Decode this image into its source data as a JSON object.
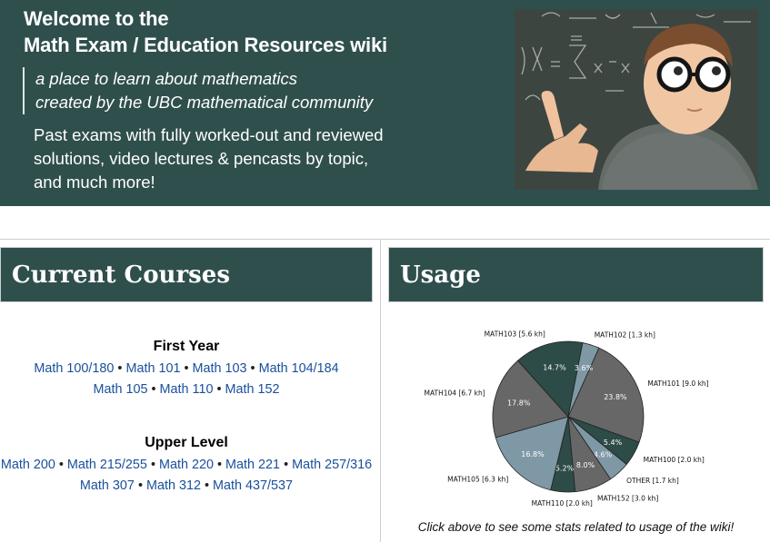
{
  "banner": {
    "title_line1": "Welcome to the",
    "title_line2": "Math Exam / Education Resources wiki",
    "tagline_line1": "a place to learn about mathematics",
    "tagline_line2": "created by the UBC mathematical community",
    "blurb_line1": "Past exams with fully worked-out and reviewed",
    "blurb_line2": "solutions, video lectures & pencasts by topic,",
    "blurb_line3": "and much more!"
  },
  "courses": {
    "heading": "Current Courses",
    "first_year": {
      "title": "First Year",
      "links": [
        "Math 100/180",
        "Math 101",
        "Math 103",
        "Math 104/184",
        "Math 105",
        "Math 110",
        "Math 152"
      ]
    },
    "upper_level": {
      "title": "Upper Level",
      "links": [
        "Math 200",
        "Math 215/255",
        "Math 220",
        "Math 221",
        "Math 257/316",
        "Math 307",
        "Math 312",
        "Math 437/537"
      ]
    }
  },
  "usage": {
    "heading": "Usage",
    "caption": "Click above to see some stats related to usage of the wiki!"
  },
  "colors": {
    "banner_bg": "#2f4f4d",
    "link": "#1a4f9c",
    "pie_gray": "#676767",
    "pie_dark": "#2d4b47",
    "pie_light": "#7f98a6"
  },
  "chart_data": {
    "type": "pie",
    "slices": [
      {
        "label": "MATH101 [9.0 kh]",
        "pct_label": "23.8%",
        "value": 23.8,
        "color": "#676767"
      },
      {
        "label": "MATH100 [2.0 kh]",
        "pct_label": "5.4%",
        "value": 5.4,
        "color": "#2d4b47"
      },
      {
        "label": "OTHER [1.7 kh]",
        "pct_label": "4.6%",
        "value": 4.6,
        "color": "#7f98a6"
      },
      {
        "label": "MATH152 [3.0 kh]",
        "pct_label": "8.0%",
        "value": 8.0,
        "color": "#676767"
      },
      {
        "label": "MATH110 [2.0 kh]",
        "pct_label": "5.2%",
        "value": 5.2,
        "color": "#2d4b47"
      },
      {
        "label": "MATH105 [6.3 kh]",
        "pct_label": "16.8%",
        "value": 16.8,
        "color": "#7f98a6"
      },
      {
        "label": "MATH104 [6.7 kh]",
        "pct_label": "17.8%",
        "value": 17.8,
        "color": "#676767"
      },
      {
        "label": "MATH103 [5.6 kh]",
        "pct_label": "14.7%",
        "value": 14.7,
        "color": "#2d4b47"
      },
      {
        "label": "MATH102 [1.3 kh]",
        "pct_label": "3.6%",
        "value": 3.6,
        "color": "#7f98a6"
      }
    ]
  }
}
